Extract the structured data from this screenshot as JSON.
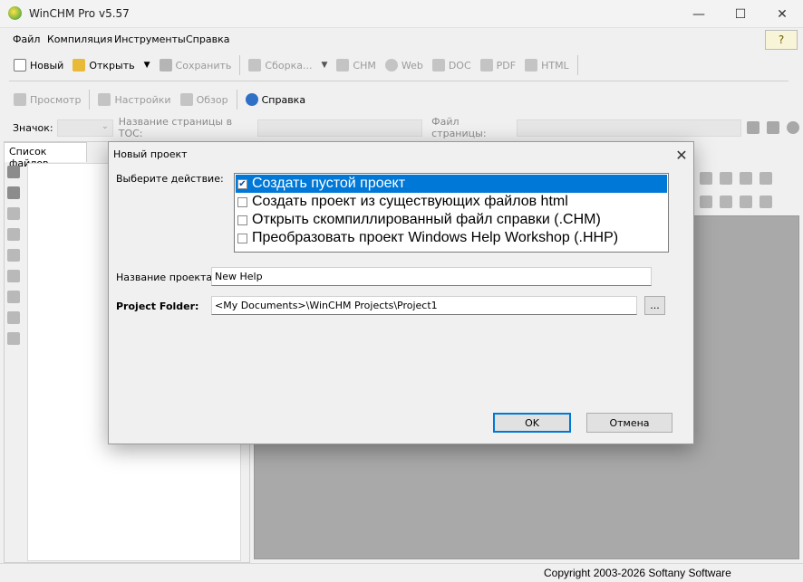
{
  "app": {
    "title": "WinCHM Pro v5.57"
  },
  "window_controls": {
    "minimize": "—",
    "maximize": "☐",
    "close": "✕"
  },
  "menu": [
    "Файл",
    "Компиляция",
    "Инструменты",
    "Справка"
  ],
  "toolbar1": {
    "new": "Новый",
    "open": "Открыть",
    "save": "Сохранить",
    "build": "Сборка...",
    "chm": "CHM",
    "web": "Web",
    "doc": "DOC",
    "pdf": "PDF",
    "html": "HTML"
  },
  "toolbar2": {
    "preview": "Просмотр",
    "settings": "Настройки",
    "browse": "Обзор",
    "help": "Справка"
  },
  "fields": {
    "icon_label": "Значок:",
    "toc_label": "Название страницы в TOC:",
    "page_file_label": "Файл страницы:"
  },
  "left_panel": {
    "tab": "Список файлов"
  },
  "dialog": {
    "title": "Новый проект",
    "close": "✕",
    "action_label": "Выберите действие:",
    "choices": [
      "Создать пустой проект",
      "Создать проект из существующих файлов html",
      "Открыть скомпиллированный файл справки (.CHM)",
      "Преобразовать проект Windows Help Workshop (.HHP)"
    ],
    "selected_choice": 0,
    "name_label": "Название проекта:",
    "name_value": "New Help",
    "folder_label": "Project Folder:",
    "folder_value": "<My Documents>\\WinCHM Projects\\Project1",
    "browse_label": "...",
    "ok": "OK",
    "cancel": "Отмена"
  },
  "status": {
    "copyright": "Copyright 2003-2026 Softany Software"
  },
  "colors": {
    "accent": "#0078d7",
    "dialog_bg": "#f0f0f0",
    "editor_bg": "#a9a9a9"
  },
  "icons": [
    "app-icon",
    "help-book-icon",
    "new-icon",
    "open-folder-icon",
    "save-icon",
    "build-icon",
    "chm-icon",
    "web-icon",
    "doc-icon",
    "pdf-icon",
    "html-icon",
    "preview-icon",
    "settings-icon",
    "browse-icon",
    "help-icon"
  ]
}
